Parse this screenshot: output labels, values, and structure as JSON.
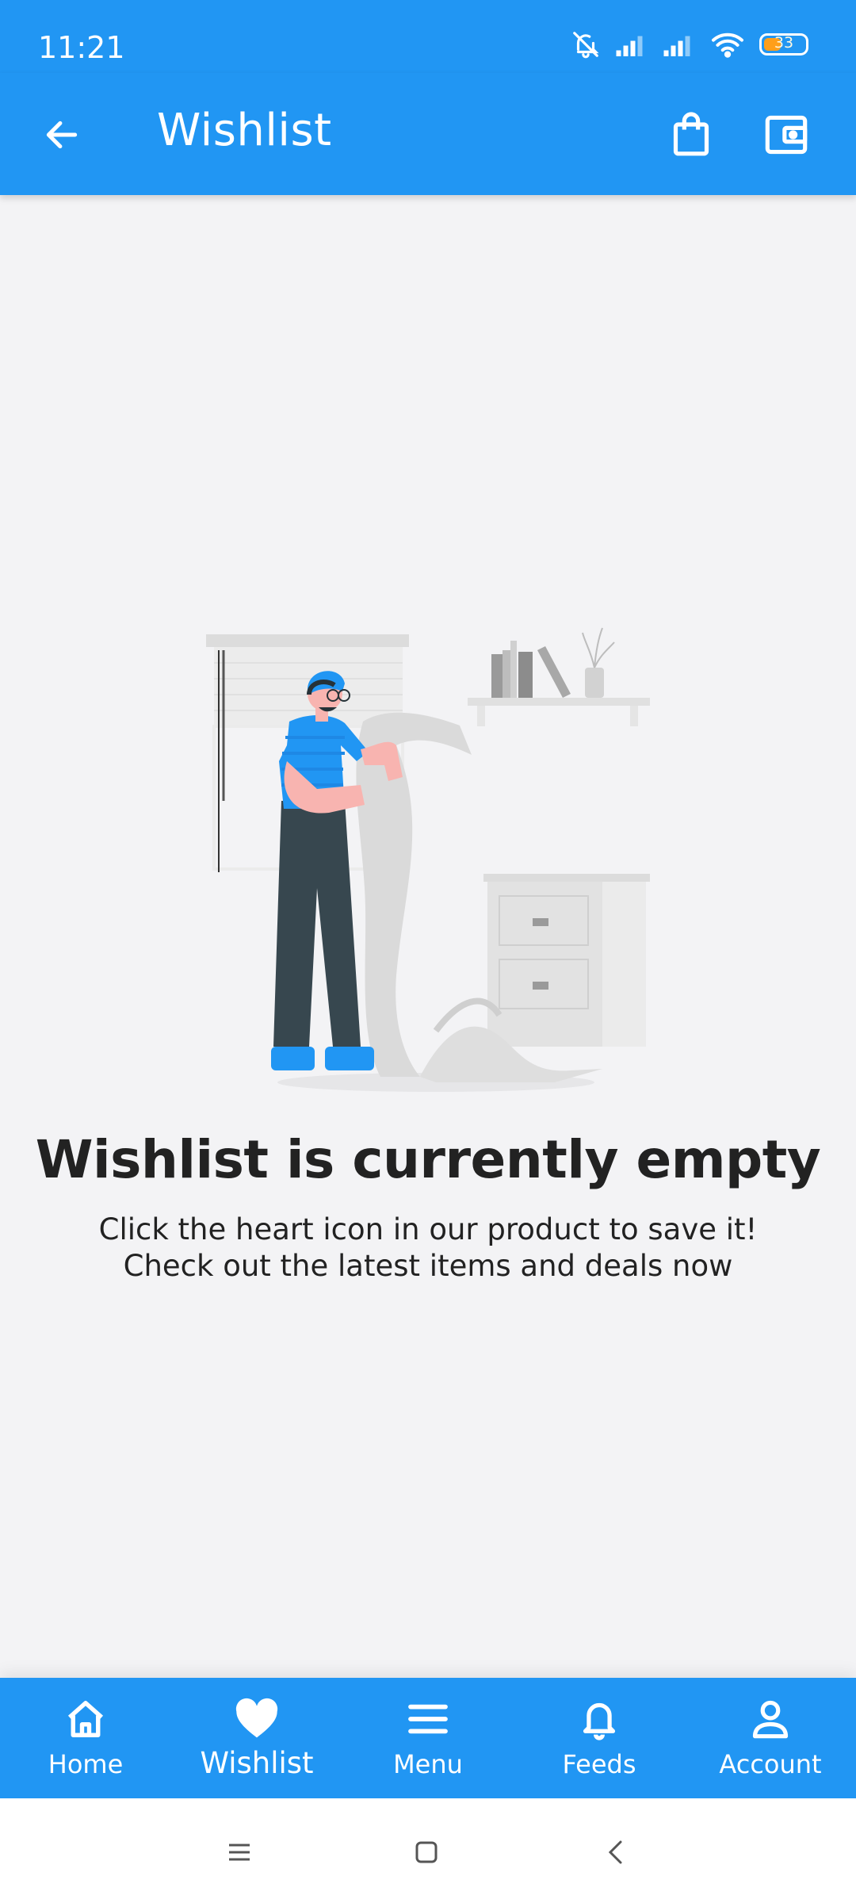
{
  "status_bar": {
    "time": "11:21",
    "battery_level": "33",
    "icons": [
      "bell-off-icon",
      "signal-icon",
      "signal-icon",
      "wifi-icon",
      "battery-icon"
    ]
  },
  "app_bar": {
    "title": "Wishlist",
    "back_icon": "arrow-left-icon",
    "actions": [
      "shopping-bag-icon",
      "wallet-icon"
    ]
  },
  "empty_state": {
    "illustration": "person-reading-long-receipt",
    "title": "Wishlist is currently empty",
    "line1": "Click the heart icon in our product to save it!",
    "line2": "Check out the latest items and deals now"
  },
  "bottom_nav": {
    "active": "Wishlist",
    "items": [
      {
        "label": "Home",
        "icon": "home-icon"
      },
      {
        "label": "Wishlist",
        "icon": "heart-icon"
      },
      {
        "label": "Menu",
        "icon": "menu-icon"
      },
      {
        "label": "Feeds",
        "icon": "bell-icon"
      },
      {
        "label": "Account",
        "icon": "person-icon"
      }
    ]
  },
  "system_nav": [
    "recents-icon",
    "home-square-icon",
    "back-chevron-icon"
  ],
  "colors": {
    "primary": "#2196f3",
    "background": "#f3f3f5",
    "text": "#222222",
    "battery": "#ff9f1a"
  }
}
